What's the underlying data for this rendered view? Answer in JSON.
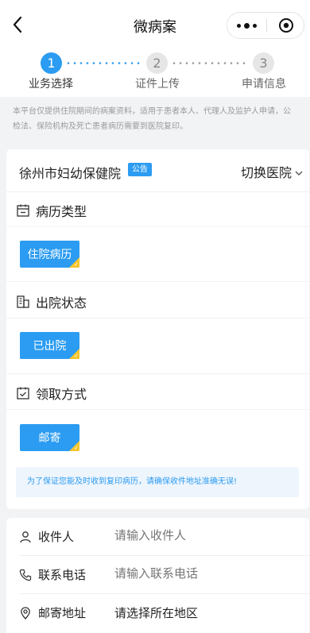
{
  "navbar": {
    "title": "微病案"
  },
  "steps": [
    {
      "number": "1",
      "label": "业务选择",
      "active": true
    },
    {
      "number": "2",
      "label": "证件上传",
      "active": false
    },
    {
      "number": "3",
      "label": "申请信息",
      "active": false
    }
  ],
  "notice_text": "本平台仅提供住院期间的病案资料，适用于患者本人、代理人及监护人申请，公检法、保险机构及死亡患者病历需要到医院复印。",
  "hospital": {
    "name": "徐州市妇幼保健院",
    "badge": "公告",
    "switch_label": "切换医院"
  },
  "sections": {
    "record_type": {
      "title": "病历类型",
      "option": "住院病历"
    },
    "discharge_status": {
      "title": "出院状态",
      "option": "已出院"
    },
    "pickup_method": {
      "title": "领取方式",
      "option": "邮寄"
    }
  },
  "tip": "为了保证您能及时收到复印病历，请确保收件地址准确无误!",
  "form": {
    "recipient": {
      "label": "收件人",
      "placeholder": "请输入收件人"
    },
    "phone": {
      "label": "联系电话",
      "placeholder": "请输入联系电话"
    },
    "address": {
      "label": "邮寄地址",
      "value": "请选择所在地区"
    }
  },
  "colors": {
    "accent": "#2b9cf2",
    "corner": "#f7c52b"
  }
}
